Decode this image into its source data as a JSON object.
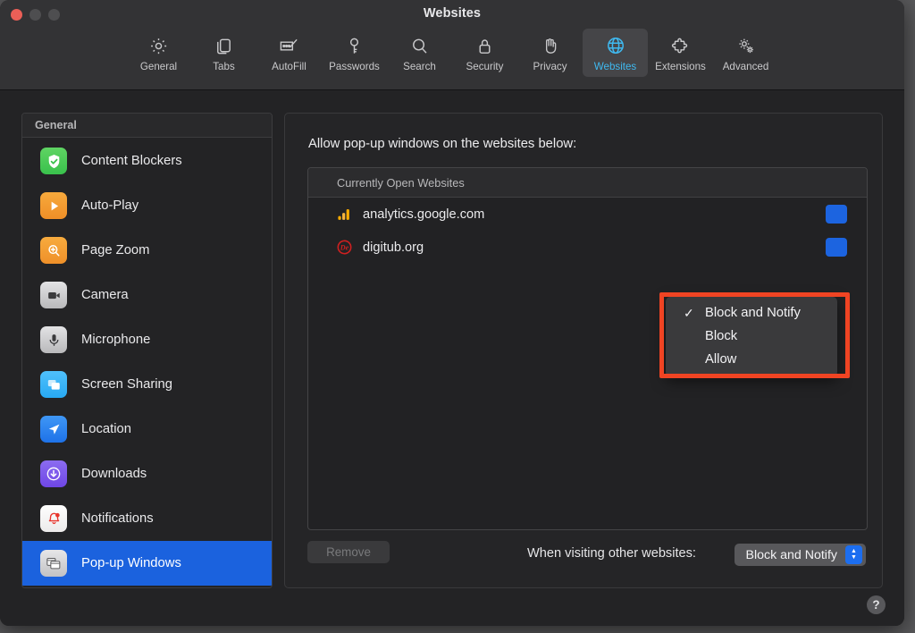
{
  "window": {
    "title": "Websites",
    "controls": {
      "close": "close-button",
      "minimize": "minimize-button",
      "maximize": "maximize-button"
    }
  },
  "toolbar": {
    "tabs": [
      {
        "label": "General",
        "icon": "gear-icon",
        "active": false
      },
      {
        "label": "Tabs",
        "icon": "tabs-icon",
        "active": false
      },
      {
        "label": "AutoFill",
        "icon": "autofill-icon",
        "active": false
      },
      {
        "label": "Passwords",
        "icon": "key-icon",
        "active": false
      },
      {
        "label": "Search",
        "icon": "magnifier-icon",
        "active": false
      },
      {
        "label": "Security",
        "icon": "lock-icon",
        "active": false
      },
      {
        "label": "Privacy",
        "icon": "hand-icon",
        "active": false
      },
      {
        "label": "Websites",
        "icon": "globe-icon",
        "active": true
      },
      {
        "label": "Extensions",
        "icon": "puzzle-icon",
        "active": false
      },
      {
        "label": "Advanced",
        "icon": "gears-icon",
        "active": false
      }
    ]
  },
  "sidebar": {
    "header": "General",
    "items": [
      {
        "label": "Content Blockers",
        "icon": "shield-check-icon",
        "selected": false
      },
      {
        "label": "Auto-Play",
        "icon": "play-icon",
        "selected": false
      },
      {
        "label": "Page Zoom",
        "icon": "zoom-in-icon",
        "selected": false
      },
      {
        "label": "Camera",
        "icon": "camera-icon",
        "selected": false
      },
      {
        "label": "Microphone",
        "icon": "microphone-icon",
        "selected": false
      },
      {
        "label": "Screen Sharing",
        "icon": "screen-share-icon",
        "selected": false
      },
      {
        "label": "Location",
        "icon": "location-icon",
        "selected": false
      },
      {
        "label": "Downloads",
        "icon": "download-icon",
        "selected": false
      },
      {
        "label": "Notifications",
        "icon": "bell-icon",
        "selected": false
      },
      {
        "label": "Pop-up Windows",
        "icon": "popup-window-icon",
        "selected": true
      }
    ]
  },
  "main": {
    "title": "Allow pop-up windows on the websites below:",
    "list_header": "Currently Open Websites",
    "sites": [
      {
        "name": "analytics.google.com",
        "icon": "google-analytics-favicon"
      },
      {
        "name": "digitub.org",
        "icon": "digitub-favicon"
      }
    ],
    "remove_button": "Remove",
    "other_websites_label": "When visiting other websites:",
    "other_websites_value": "Block and Notify"
  },
  "dropdown_menu": {
    "open": true,
    "selected": "Block and Notify",
    "options": [
      {
        "label": "Block and Notify",
        "checked": true
      },
      {
        "label": "Block",
        "checked": false
      },
      {
        "label": "Allow",
        "checked": false
      }
    ],
    "highlight_color": "#f04423"
  },
  "help": {
    "label": "?"
  },
  "colors": {
    "accent_blue": "#1b62de",
    "active_tab_blue": "#3fb9f0",
    "highlight_red": "#f04423",
    "window_bg": "#232325",
    "titlebar_bg": "#333335"
  }
}
